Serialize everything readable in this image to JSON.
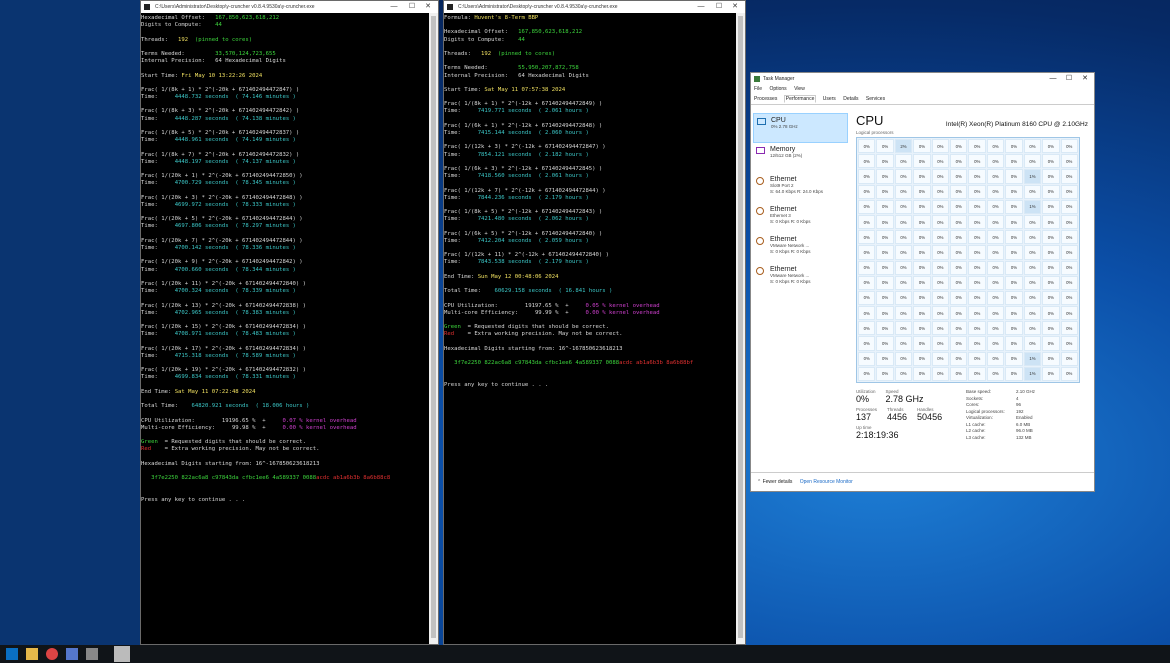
{
  "win1": {
    "title": "C:\\Users\\Administrator\\Desktop\\y-cruncher v0.8.4.9530a\\y-cruncher.exe",
    "lines": [
      [
        [
          "Hexadecimal Offset:   ",
          "w"
        ],
        [
          "167,850,623,618,212",
          "g"
        ]
      ],
      [
        [
          "Digits to Compute:    ",
          "w"
        ],
        [
          "44",
          "g"
        ]
      ],
      [],
      [
        [
          "Threads:   ",
          "w"
        ],
        [
          "192",
          "y"
        ],
        [
          "  (pinned to cores)",
          "g"
        ]
      ],
      [],
      [
        [
          "Terms Needed:         ",
          "w"
        ],
        [
          "33,570,124,723,655",
          "g"
        ]
      ],
      [
        [
          "Internal Precision:   ",
          "w"
        ],
        [
          "64 Hexadecimal Digits",
          "w"
        ]
      ],
      [],
      [
        [
          "Start Time: ",
          "w"
        ],
        [
          "Fri May 10 13:22:26 2024",
          "y"
        ]
      ],
      [],
      [
        [
          "Frac( 1/(8k + 1) * 2^(-20k + 671402494472847) )",
          "w"
        ]
      ],
      [
        [
          "Time:     ",
          "w"
        ],
        [
          "4448.732 seconds  ( 74.146 minutes )",
          "c"
        ]
      ],
      [],
      [
        [
          "Frac( 1/(8k + 3) * 2^(-20k + 671402494472842) )",
          "w"
        ]
      ],
      [
        [
          "Time:     ",
          "w"
        ],
        [
          "4448.287 seconds  ( 74.138 minutes )",
          "c"
        ]
      ],
      [],
      [
        [
          "Frac( 1/(8k + 5) * 2^(-20k + 671402494472837) )",
          "w"
        ]
      ],
      [
        [
          "Time:     ",
          "w"
        ],
        [
          "4448.961 seconds  ( 74.149 minutes )",
          "c"
        ]
      ],
      [],
      [
        [
          "Frac( 1/(8k + 7) * 2^(-20k + 671402494472832) )",
          "w"
        ]
      ],
      [
        [
          "Time:     ",
          "w"
        ],
        [
          "4448.197 seconds  ( 74.137 minutes )",
          "c"
        ]
      ],
      [],
      [
        [
          "Frac( 1/(20k + 1) * 2^(-20k + 671402494472850) )",
          "w"
        ]
      ],
      [
        [
          "Time:     ",
          "w"
        ],
        [
          "4700.729 seconds  ( 78.345 minutes )",
          "c"
        ]
      ],
      [],
      [
        [
          "Frac( 1/(20k + 3) * 2^(-20k + 671402494472848) )",
          "w"
        ]
      ],
      [
        [
          "Time:     ",
          "w"
        ],
        [
          "4699.972 seconds  ( 78.333 minutes )",
          "c"
        ]
      ],
      [],
      [
        [
          "Frac( 1/(20k + 5) * 2^(-20k + 671402494472844) )",
          "w"
        ]
      ],
      [
        [
          "Time:     ",
          "w"
        ],
        [
          "4697.806 seconds  ( 78.297 minutes )",
          "c"
        ]
      ],
      [],
      [
        [
          "Frac( 1/(20k + 7) * 2^(-20k + 671402494472844) )",
          "w"
        ]
      ],
      [
        [
          "Time:     ",
          "w"
        ],
        [
          "4700.142 seconds  ( 78.336 minutes )",
          "c"
        ]
      ],
      [],
      [
        [
          "Frac( 1/(20k + 9) * 2^(-20k + 671402494472842) )",
          "w"
        ]
      ],
      [
        [
          "Time:     ",
          "w"
        ],
        [
          "4700.660 seconds  ( 78.344 minutes )",
          "c"
        ]
      ],
      [],
      [
        [
          "Frac( 1/(20k + 11) * 2^(-20k + 671402494472840) )",
          "w"
        ]
      ],
      [
        [
          "Time:     ",
          "w"
        ],
        [
          "4700.324 seconds  ( 78.339 minutes )",
          "c"
        ]
      ],
      [],
      [
        [
          "Frac( 1/(20k + 13) * 2^(-20k + 671402494472838) )",
          "w"
        ]
      ],
      [
        [
          "Time:     ",
          "w"
        ],
        [
          "4702.965 seconds  ( 78.383 minutes )",
          "c"
        ]
      ],
      [],
      [
        [
          "Frac( 1/(20k + 15) * 2^(-20k + 671402494472834) )",
          "w"
        ]
      ],
      [
        [
          "Time:     ",
          "w"
        ],
        [
          "4708.971 seconds  ( 78.483 minutes )",
          "c"
        ]
      ],
      [],
      [
        [
          "Frac( 1/(20k + 17) * 2^(-20k + 671402494472834) )",
          "w"
        ]
      ],
      [
        [
          "Time:     ",
          "w"
        ],
        [
          "4715.318 seconds  ( 78.589 minutes )",
          "c"
        ]
      ],
      [],
      [
        [
          "Frac( 1/(20k + 19) * 2^(-20k + 671402494472832) )",
          "w"
        ]
      ],
      [
        [
          "Time:     ",
          "w"
        ],
        [
          "4699.834 seconds  ( 78.331 minutes )",
          "c"
        ]
      ],
      [],
      [
        [
          "End Time: ",
          "w"
        ],
        [
          "Sat May 11 07:22:48 2024",
          "y"
        ]
      ],
      [],
      [
        [
          "Total Time:    ",
          "w"
        ],
        [
          "64820.921 seconds  ( 18.006 hours )",
          "c"
        ]
      ],
      [],
      [
        [
          "CPU Utilization:        ",
          "w"
        ],
        [
          "19196.65 %",
          "w"
        ],
        [
          "  +     ",
          "w"
        ],
        [
          "0.07 % kernel overhead",
          "m"
        ]
      ],
      [
        [
          "Multi-core Efficiency:     ",
          "w"
        ],
        [
          "99.98 %",
          "w"
        ],
        [
          "  +     ",
          "w"
        ],
        [
          "0.00 % kernel overhead",
          "m"
        ]
      ],
      [],
      [
        [
          "Green",
          "g"
        ],
        [
          "  = Requested digits that should be correct.",
          "w"
        ]
      ],
      [
        [
          "Red",
          "r"
        ],
        [
          "    = Extra working precision. May not be correct.",
          "w"
        ]
      ],
      [],
      [
        [
          "Hexadecimal Digits starting from: 16^-167850623618213",
          "w"
        ]
      ],
      [],
      [
        [
          "   3f7e2250 822ac6a8 c97843da cfbc1ee6 4a589337 0088",
          "g"
        ],
        [
          "acdc ab1a6b3b 8a6b88c8",
          "r"
        ]
      ],
      [],
      [],
      [
        [
          "Press any key to continue . . .",
          "w"
        ]
      ]
    ]
  },
  "win2": {
    "title": "C:\\Users\\Administrator\\Desktop\\y-cruncher v0.8.4.9530a\\y-cruncher.exe",
    "lines": [
      [
        [
          "Formula: ",
          "w"
        ],
        [
          "Huvent's 8-Term BBP",
          "y"
        ]
      ],
      [],
      [
        [
          "Hexadecimal Offset:   ",
          "w"
        ],
        [
          "167,850,623,618,212",
          "g"
        ]
      ],
      [
        [
          "Digits to Compute:    ",
          "w"
        ],
        [
          "44",
          "g"
        ]
      ],
      [],
      [
        [
          "Threads:   ",
          "w"
        ],
        [
          "192",
          "y"
        ],
        [
          "  (pinned to cores)",
          "g"
        ]
      ],
      [],
      [
        [
          "Terms Needed:         ",
          "w"
        ],
        [
          "55,950,207,872,758",
          "g"
        ]
      ],
      [
        [
          "Internal Precision:   ",
          "w"
        ],
        [
          "64 Hexadecimal Digits",
          "w"
        ]
      ],
      [],
      [
        [
          "Start Time: ",
          "w"
        ],
        [
          "Sat May 11 07:57:38 2024",
          "y"
        ]
      ],
      [],
      [
        [
          "Frac( 1/(8k + 1) * 2^(-12k + 671402494472849) )",
          "w"
        ]
      ],
      [
        [
          "Time:     ",
          "w"
        ],
        [
          "7419.771 seconds  ( 2.061 hours )",
          "c"
        ]
      ],
      [],
      [
        [
          "Frac( 1/(6k + 1) * 2^(-12k + 671402494472848) )",
          "w"
        ]
      ],
      [
        [
          "Time:     ",
          "w"
        ],
        [
          "7415.144 seconds  ( 2.060 hours )",
          "c"
        ]
      ],
      [],
      [
        [
          "Frac( 1/(12k + 3) * 2^(-12k + 671402494472847) )",
          "w"
        ]
      ],
      [
        [
          "Time:     ",
          "w"
        ],
        [
          "7854.121 seconds  ( 2.182 hours )",
          "c"
        ]
      ],
      [],
      [
        [
          "Frac( 1/(6k + 3) * 2^(-12k + 671402494472845) )",
          "w"
        ]
      ],
      [
        [
          "Time:     ",
          "w"
        ],
        [
          "7418.560 seconds  ( 2.061 hours )",
          "c"
        ]
      ],
      [],
      [
        [
          "Frac( 1/(12k + 7) * 2^(-12k + 671402494472844) )",
          "w"
        ]
      ],
      [
        [
          "Time:     ",
          "w"
        ],
        [
          "7844.236 seconds  ( 2.179 hours )",
          "c"
        ]
      ],
      [],
      [
        [
          "Frac( 1/(8k + 5) * 2^(-12k + 671402494472843) )",
          "w"
        ]
      ],
      [
        [
          "Time:     ",
          "w"
        ],
        [
          "7421.480 seconds  ( 2.062 hours )",
          "c"
        ]
      ],
      [],
      [
        [
          "Frac( 1/(6k + 5) * 2^(-12k + 671402494472840) )",
          "w"
        ]
      ],
      [
        [
          "Time:     ",
          "w"
        ],
        [
          "7412.204 seconds  ( 2.059 hours )",
          "c"
        ]
      ],
      [],
      [
        [
          "Frac( 1/(12k + 11) * 2^(-12k + 671402494472840) )",
          "w"
        ]
      ],
      [
        [
          "Time:     ",
          "w"
        ],
        [
          "7843.538 seconds  ( 2.179 hours )",
          "c"
        ]
      ],
      [],
      [
        [
          "End Time: ",
          "w"
        ],
        [
          "Sun May 12 00:48:06 2024",
          "y"
        ]
      ],
      [],
      [
        [
          "Total Time:    ",
          "w"
        ],
        [
          "60629.158 seconds  ( 16.841 hours )",
          "c"
        ]
      ],
      [],
      [
        [
          "CPU Utilization:        ",
          "w"
        ],
        [
          "19197.65 %",
          "w"
        ],
        [
          "  +     ",
          "w"
        ],
        [
          "0.05 % kernel overhead",
          "m"
        ]
      ],
      [
        [
          "Multi-core Efficiency:     ",
          "w"
        ],
        [
          "99.99 %",
          "w"
        ],
        [
          "  +     ",
          "w"
        ],
        [
          "0.00 % kernel overhead",
          "m"
        ]
      ],
      [],
      [
        [
          "Green",
          "g"
        ],
        [
          "  = Requested digits that should be correct.",
          "w"
        ]
      ],
      [
        [
          "Red",
          "r"
        ],
        [
          "    = Extra working precision. May not be correct.",
          "w"
        ]
      ],
      [],
      [
        [
          "Hexadecimal Digits starting from: 16^-167850623618213",
          "w"
        ]
      ],
      [],
      [
        [
          "   3f7e2250 822ac6a8 c97843da cfbc1ee6 4a589337 0088",
          "g"
        ],
        [
          "acdc ab1a6b3b 8a6b88bf",
          "r"
        ]
      ],
      [],
      [],
      [
        [
          "Press any key to continue . . .",
          "w"
        ]
      ]
    ]
  },
  "taskmgr": {
    "title": "Task Manager",
    "menu": [
      "File",
      "Options",
      "View"
    ],
    "tabs": [
      "Processes",
      "Performance",
      "Users",
      "Details",
      "Services"
    ],
    "side": [
      {
        "name": "CPU",
        "sub": "0% 2.78 GHz",
        "sub2": "",
        "icon": "cpu-icon"
      },
      {
        "name": "Memory",
        "sub": "12/512 GB (2%)",
        "sub2": "",
        "icon": "memory-icon"
      },
      {
        "name": "Ethernet",
        "sub": "Slot9 Port 2",
        "sub2": "S: 64.0 Kbps  R: 24.0 Kbps",
        "icon": "ethernet-icon"
      },
      {
        "name": "Ethernet",
        "sub": "Ethernet 3",
        "sub2": "S: 0 Kbps  R: 0 Kbps",
        "icon": "ethernet-icon"
      },
      {
        "name": "Ethernet",
        "sub": "VMware Network ...",
        "sub2": "S: 0 Kbps  R: 0 Kbps",
        "icon": "ethernet-icon"
      },
      {
        "name": "Ethernet",
        "sub": "VMware Network ...",
        "sub2": "S: 0 Kbps  R: 0 Kbps",
        "icon": "ethernet-icon"
      }
    ],
    "cpu_heading": "CPU",
    "cpu_name": "Intel(R) Xeon(R) Platinum 8160 CPU @ 2.10GHz",
    "logical_label": "Logical processors",
    "grid_highlight": {
      "2": "2%",
      "33": "1%",
      "57": "1%",
      "189": "1%",
      "177": "1%"
    },
    "stats": {
      "utilization_label": "Utilization",
      "utilization": "0%",
      "speed_label": "Speed",
      "speed": "2.78 GHz",
      "processes_label": "Processes",
      "processes": "137",
      "threads_label": "Threads",
      "threads": "4456",
      "handles_label": "Handles",
      "handles": "50456",
      "uptime_label": "Up time",
      "uptime": "2:18:19:36"
    },
    "specs": [
      [
        "Base speed:",
        "2.10 GHz"
      ],
      [
        "Sockets:",
        "4"
      ],
      [
        "Cores:",
        "96"
      ],
      [
        "Logical processors:",
        "192"
      ],
      [
        "Virtualization:",
        "Enabled"
      ],
      [
        "L1 cache:",
        "6.0 MB"
      ],
      [
        "L2 cache:",
        "96.0 MB"
      ],
      [
        "L3 cache:",
        "132 MB"
      ]
    ],
    "fewer_details": "Fewer details",
    "resource_monitor": "Open Resource Monitor"
  },
  "window_controls": {
    "minimize": "—",
    "maximize": "☐",
    "close": "✕"
  }
}
